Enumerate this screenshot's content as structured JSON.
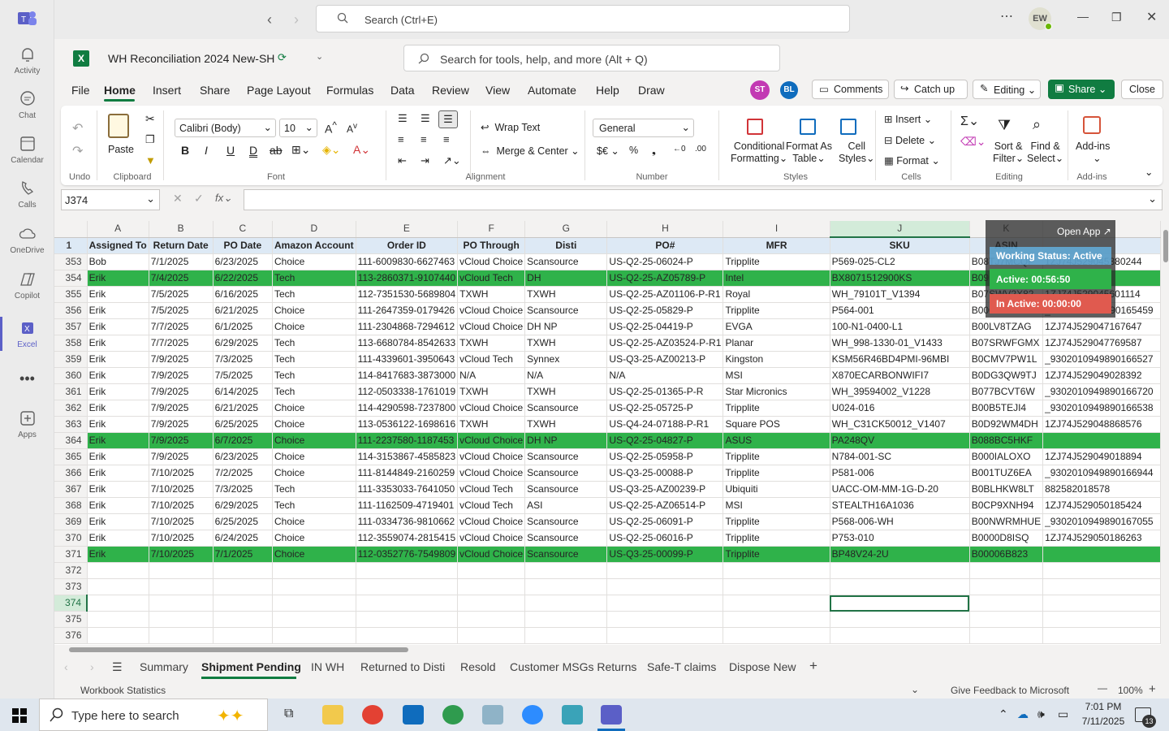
{
  "teams": {
    "search_placeholder": "Search (Ctrl+E)",
    "avatar": "EW",
    "rail": [
      {
        "label": "Activity",
        "icon": "bell-icon"
      },
      {
        "label": "Chat",
        "icon": "chat-icon"
      },
      {
        "label": "Calendar",
        "icon": "calendar-icon"
      },
      {
        "label": "Calls",
        "icon": "phone-icon"
      },
      {
        "label": "OneDrive",
        "icon": "cloud-icon"
      },
      {
        "label": "Copilot",
        "icon": "copilot-icon"
      },
      {
        "label": "Excel",
        "icon": "excel-icon"
      },
      {
        "label": "Apps",
        "icon": "apps-icon"
      }
    ]
  },
  "excel": {
    "title": "WH Reconciliation 2024 New-SH",
    "search_placeholder": "Search for tools, help, and more (Alt + Q)",
    "avatars": [
      "ST",
      "BL"
    ],
    "buttons": {
      "comments": "Comments",
      "catchup": "Catch up",
      "editing": "Editing",
      "share": "Share",
      "close": "Close"
    },
    "tabs": [
      "File",
      "Home",
      "Insert",
      "Share",
      "Page Layout",
      "Formulas",
      "Data",
      "Review",
      "View",
      "Automate",
      "Help",
      "Draw"
    ],
    "active_tab": "Home",
    "ribbon": {
      "undo": "Undo",
      "paste": "Paste",
      "clipboard": "Clipboard",
      "font_name": "Calibri (Body)",
      "font_size": "10",
      "font": "Font",
      "wrap": "Wrap Text",
      "merge": "Merge & Center",
      "alignment": "Alignment",
      "number_format": "General",
      "number": "Number",
      "cond1": "Conditional",
      "cond2": "Formatting",
      "fmt1": "Format As",
      "fmt2": "Table",
      "cell1": "Cell",
      "cell2": "Styles",
      "styles": "Styles",
      "insert": "Insert",
      "delete": "Delete",
      "format": "Format",
      "cells": "Cells",
      "sort1": "Sort &",
      "sort2": "Filter",
      "find1": "Find &",
      "find2": "Select",
      "editing": "Editing",
      "addins1": "Add-ins",
      "addins": "Add-ins"
    },
    "name_box": "J374",
    "columns": [
      "A",
      "B",
      "C",
      "D",
      "E",
      "F",
      "G",
      "H",
      "I",
      "J",
      "K",
      ""
    ],
    "headers": [
      "Assigned To",
      "Return Date",
      "PO Date",
      "Amazon Account",
      "Order ID",
      "PO Through",
      "Disti",
      "PO#",
      "MFR",
      "SKU",
      "ASIN",
      ""
    ],
    "rows": [
      {
        "n": "353",
        "hl": false,
        "c": [
          "Bob",
          "7/1/2025",
          "6/23/2025",
          "Choice",
          "111-6009830-6627463",
          "vCloud Choice",
          "Scansource",
          "US-Q2-25-06024-P",
          "Tripplite",
          "P569-025-CL2",
          "B08TJ7MCQP",
          "1ZJ74J529045380244"
        ]
      },
      {
        "n": "354",
        "hl": true,
        "c": [
          "Erik",
          "7/4/2025",
          "6/22/2025",
          "Tech",
          "113-2860371-9107440",
          "vCloud Tech",
          "DH",
          "US-Q2-25-AZ05789-P",
          "Intel",
          "BX8071512900KS",
          "B09",
          "",
          ""
        ]
      },
      {
        "n": "355",
        "hl": false,
        "c": [
          "Erik",
          "7/5/2025",
          "6/16/2025",
          "Tech",
          "112-7351530-5689804",
          "TXWH",
          "TXWH",
          "US-Q2-25-AZ01106-P-R1",
          "Royal",
          "WH_79101T_V1394",
          "B07SWV2X82",
          "1ZJ74J529045601114"
        ]
      },
      {
        "n": "356",
        "hl": false,
        "c": [
          "Erik",
          "7/5/2025",
          "6/21/2025",
          "Choice",
          "111-2647359-0179426",
          "vCloud Choice",
          "Scansource",
          "US-Q2-25-05829-P",
          "Tripplite",
          "P564-001",
          "B000VLZ986",
          "_9302010949890165459"
        ]
      },
      {
        "n": "357",
        "hl": false,
        "c": [
          "Erik",
          "7/7/2025",
          "6/1/2025",
          "Choice",
          "111-2304868-7294612",
          "vCloud Choice",
          "DH NP",
          "US-Q2-25-04419-P",
          "EVGA",
          "100-N1-0400-L1",
          "B00LV8TZAG",
          "1ZJ74J529047167647"
        ]
      },
      {
        "n": "358",
        "hl": false,
        "c": [
          "Erik",
          "7/7/2025",
          "6/29/2025",
          "Tech",
          "113-6680784-8542633",
          "TXWH",
          "TXWH",
          "US-Q2-25-AZ03524-P-R1",
          "Planar",
          "WH_998-1330-01_V1433",
          "B07SRWFGMX",
          "1ZJ74J529047769587"
        ]
      },
      {
        "n": "359",
        "hl": false,
        "c": [
          "Erik",
          "7/9/2025",
          "7/3/2025",
          "Tech",
          "111-4339601-3950643",
          "vCloud Tech",
          "Synnex",
          "US-Q3-25-AZ00213-P",
          "Kingston",
          "KSM56R46BD4PMI-96MBI",
          "B0CMV7PW1L",
          "_9302010949890166527"
        ]
      },
      {
        "n": "360",
        "hl": false,
        "c": [
          "Erik",
          "7/9/2025",
          "7/5/2025",
          "Tech",
          "114-8417683-3873000",
          "N/A",
          "N/A",
          "N/A",
          "MSI",
          "X870ECARBONWIFI7",
          "B0DG3QW9TJ",
          "1ZJ74J529049028392"
        ]
      },
      {
        "n": "361",
        "hl": false,
        "c": [
          "Erik",
          "7/9/2025",
          "6/14/2025",
          "Tech",
          "112-0503338-1761019",
          "TXWH",
          "TXWH",
          "US-Q2-25-01365-P-R",
          "Star Micronics",
          "WH_39594002_V1228",
          "B077BCVT6W",
          "_9302010949890166720"
        ]
      },
      {
        "n": "362",
        "hl": false,
        "c": [
          "Erik",
          "7/9/2025",
          "6/21/2025",
          "Choice",
          "114-4290598-7237800",
          "vCloud Choice",
          "Scansource",
          "US-Q2-25-05725-P",
          "Tripplite",
          "U024-016",
          "B00B5TEJI4",
          "_9302010949890166538"
        ]
      },
      {
        "n": "363",
        "hl": false,
        "c": [
          "Erik",
          "7/9/2025",
          "6/25/2025",
          "Choice",
          "113-0536122-1698616",
          "TXWH",
          "TXWH",
          "US-Q4-24-07188-P-R1",
          "Square POS",
          "WH_C31CK50012_V1407",
          "B0D92WM4DH",
          "1ZJ74J529048868576"
        ]
      },
      {
        "n": "364",
        "hl": true,
        "c": [
          "Erik",
          "7/9/2025",
          "6/7/2025",
          "Choice",
          "111-2237580-1187453",
          "vCloud Choice",
          "DH NP",
          "US-Q2-25-04827-P",
          "ASUS",
          "PA248QV",
          "B088BC5HKF",
          ""
        ]
      },
      {
        "n": "365",
        "hl": false,
        "c": [
          "Erik",
          "7/9/2025",
          "6/23/2025",
          "Choice",
          "114-3153867-4585823",
          "vCloud Choice",
          "Scansource",
          "US-Q2-25-05958-P",
          "Tripplite",
          "N784-001-SC",
          "B000IALOXO",
          "1ZJ74J529049018894"
        ]
      },
      {
        "n": "366",
        "hl": false,
        "c": [
          "Erik",
          "7/10/2025",
          "7/2/2025",
          "Choice",
          "111-8144849-2160259",
          "vCloud Choice",
          "Scansource",
          "US-Q3-25-00088-P",
          "Tripplite",
          "P581-006",
          "B001TUZ6EA",
          "_9302010949890166944"
        ]
      },
      {
        "n": "367",
        "hl": false,
        "c": [
          "Erik",
          "7/10/2025",
          "7/3/2025",
          "Tech",
          "111-3353033-7641050",
          "vCloud Tech",
          "Scansource",
          "US-Q3-25-AZ00239-P",
          "Ubiquiti",
          "UACC-OM-MM-1G-D-20",
          "B0BLHKW8LT",
          "882582018578"
        ]
      },
      {
        "n": "368",
        "hl": false,
        "c": [
          "Erik",
          "7/10/2025",
          "6/29/2025",
          "Tech",
          "111-1162509-4719401",
          "vCloud Tech",
          "ASI",
          "US-Q2-25-AZ06514-P",
          "MSI",
          "STEALTH16A1036",
          "B0CP9XNH94",
          "1ZJ74J529050185424"
        ]
      },
      {
        "n": "369",
        "hl": false,
        "c": [
          "Erik",
          "7/10/2025",
          "6/25/2025",
          "Choice",
          "111-0334736-9810662",
          "vCloud Choice",
          "Scansource",
          "US-Q2-25-06091-P",
          "Tripplite",
          "P568-006-WH",
          "B00NWRMHUE",
          "_9302010949890167055"
        ]
      },
      {
        "n": "370",
        "hl": false,
        "c": [
          "Erik",
          "7/10/2025",
          "6/24/2025",
          "Choice",
          "112-3559074-2815415",
          "vCloud Choice",
          "Scansource",
          "US-Q2-25-06016-P",
          "Tripplite",
          "P753-010",
          "B0000D8ISQ",
          "1ZJ74J529050186263"
        ]
      },
      {
        "n": "371",
        "hl": true,
        "c": [
          "Erik",
          "7/10/2025",
          "7/1/2025",
          "Choice",
          "112-0352776-7549809",
          "vCloud Choice",
          "Scansource",
          "US-Q3-25-00099-P",
          "Tripplite",
          "BP48V24-2U",
          "B00006B823",
          ""
        ]
      },
      {
        "n": "372",
        "hl": false,
        "c": [
          "",
          "",
          "",
          "",
          "",
          "",
          "",
          "",
          "",
          "",
          "",
          ""
        ]
      },
      {
        "n": "373",
        "hl": false,
        "c": [
          "",
          "",
          "",
          "",
          "",
          "",
          "",
          "",
          "",
          "",
          "",
          ""
        ]
      },
      {
        "n": "374",
        "hl": false,
        "c": [
          "",
          "",
          "",
          "",
          "",
          "",
          "",
          "",
          "",
          "",
          "",
          ""
        ]
      },
      {
        "n": "375",
        "hl": false,
        "c": [
          "",
          "",
          "",
          "",
          "",
          "",
          "",
          "",
          "",
          "",
          "",
          ""
        ]
      },
      {
        "n": "376",
        "hl": false,
        "c": [
          "",
          "",
          "",
          "",
          "",
          "",
          "",
          "",
          "",
          "",
          "",
          ""
        ]
      }
    ],
    "overlay": {
      "open_app": "Open App",
      "status": "Working Status: Active",
      "active": "Active: 00:56:50",
      "inactive": "In Active: 00:00:00"
    },
    "sheets": [
      "Summary",
      "Shipment Pending",
      "IN WH",
      "Returned to Disti",
      "Resold",
      "Customer MSGs Returns",
      "Safe-T claims",
      "Dispose New"
    ],
    "active_sheet": "Shipment Pending",
    "status_left": "Workbook Statistics",
    "feedback": "Give Feedback to Microsoft",
    "zoom": "100%"
  },
  "taskbar": {
    "search": "Type here to search",
    "time": "7:01 PM",
    "date": "7/11/2025",
    "notif": "13"
  }
}
